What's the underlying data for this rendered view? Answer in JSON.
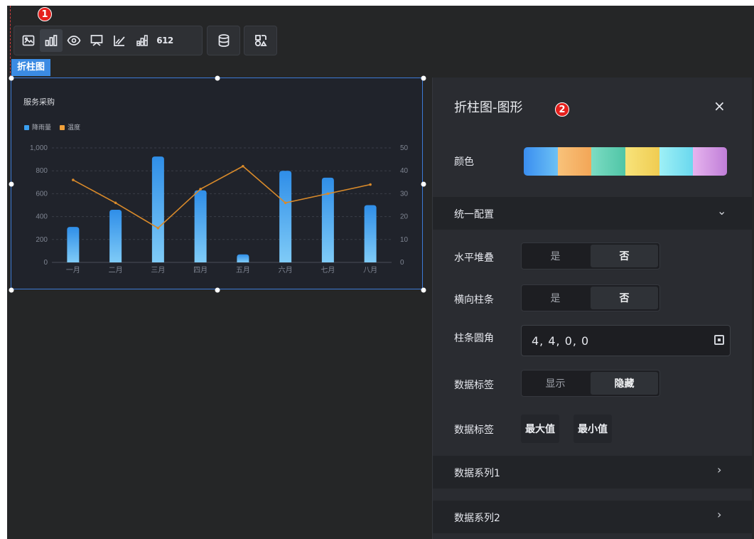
{
  "toolbar": {
    "group1_icons": [
      "image-icon",
      "bar-chart-icon",
      "radar-icon",
      "comment-icon",
      "axis-chart-icon",
      "stacked-bar-icon",
      "number-icon"
    ],
    "number_label": "612",
    "active_icon": "bar-chart-icon",
    "group2_icon": "database-icon",
    "group3_icon": "shapes-icon",
    "badge1": "1"
  },
  "component": {
    "tag": "折柱图",
    "chart_title": "服务采购",
    "legend": [
      {
        "label": "降雨量",
        "color": "#3a9ff0"
      },
      {
        "label": "温度",
        "color": "#f0a03a"
      }
    ]
  },
  "chart_data": {
    "type": "bar",
    "title": "服务采购",
    "categories": [
      "一月",
      "二月",
      "三月",
      "四月",
      "五月",
      "六月",
      "七月",
      "八月"
    ],
    "series": [
      {
        "name": "降雨量",
        "type": "bar",
        "axis": "left",
        "values": [
          310,
          460,
          925,
          630,
          70,
          800,
          740,
          500
        ]
      },
      {
        "name": "温度",
        "type": "line",
        "axis": "right",
        "values": [
          36,
          26,
          15,
          32,
          42,
          26,
          30,
          34
        ]
      }
    ],
    "y_left": {
      "ylim": [
        0,
        1000
      ],
      "ticks": [
        0,
        200,
        400,
        600,
        800,
        "1,000"
      ]
    },
    "y_right": {
      "ylim": [
        0,
        50
      ],
      "ticks": [
        0,
        10,
        20,
        30,
        40,
        50
      ]
    },
    "colors": {
      "bar_top": "#2f8ee8",
      "bar_bottom": "#7fcbf7",
      "line": "#d98a2a"
    },
    "grid": true,
    "legend_position": "top-left"
  },
  "panel": {
    "title": "折柱图-图形",
    "badge2": "2",
    "close_glyph": "×",
    "color_label": "颜色",
    "palette": [
      [
        "#3a8ef0",
        "#6cc1f5"
      ],
      [
        "#f8c27a",
        "#f3a657"
      ],
      [
        "#7cdcc3",
        "#4fc5a6"
      ],
      [
        "#f7e37a",
        "#f0cc52"
      ],
      [
        "#9ef0f6",
        "#6ad8ee"
      ],
      [
        "#e6b4ee",
        "#c07ed8"
      ]
    ],
    "section_unified": "统一配置",
    "section_unified_chev": "⌄",
    "h_stack": {
      "label": "水平堆叠",
      "options": [
        "是",
        "否"
      ],
      "selected": "否"
    },
    "h_bars": {
      "label": "横向柱条",
      "options": [
        "是",
        "否"
      ],
      "selected": "否"
    },
    "bar_radius": {
      "label": "柱条圆角",
      "value": "4,  4,  0,  0"
    },
    "data_label_toggle": {
      "label": "数据标签",
      "options": [
        "显示",
        "隐藏"
      ],
      "selected": "隐藏"
    },
    "data_label_chips": {
      "label": "数据标签",
      "chips": [
        "最大值",
        "最小值"
      ]
    },
    "series1": "数据系列1",
    "series2": "数据系列2",
    "section_chev": "›"
  }
}
